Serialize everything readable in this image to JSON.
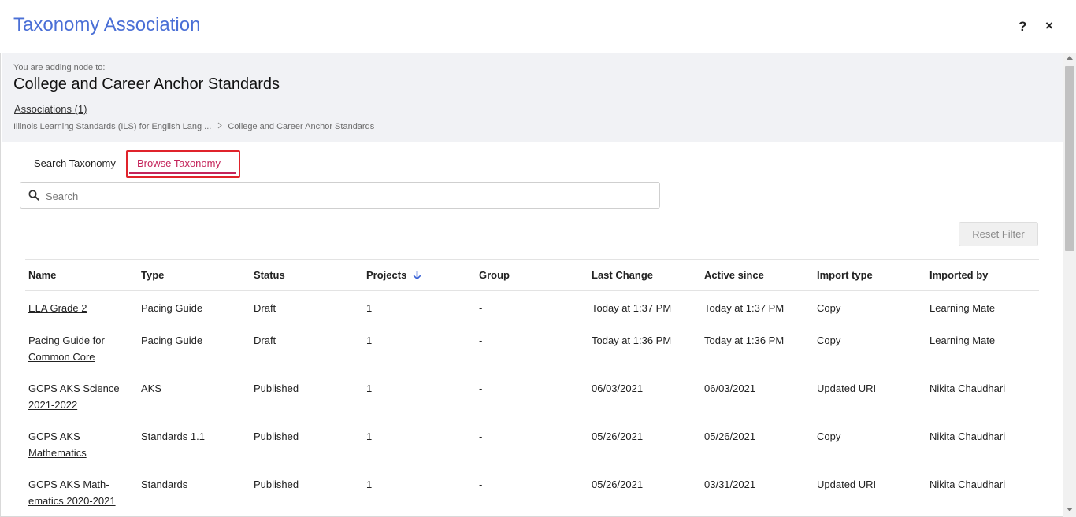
{
  "dialog": {
    "title": "Taxonomy Association",
    "help_label": "?",
    "close_label": "×"
  },
  "context": {
    "label": "You are adding node to:",
    "title": "College and Career Anchor Standards",
    "associations_link": "Associations (1)",
    "breadcrumb": [
      "Illinois Learning Standards (ILS) for English Lang ...",
      "College and Career Anchor Standards"
    ]
  },
  "tabs": {
    "search": "Search Taxonomy",
    "browse": "Browse Taxonomy",
    "active": "browse"
  },
  "search": {
    "placeholder": "Search",
    "value": ""
  },
  "reset_filter_label": "Reset Filter",
  "table": {
    "columns": [
      "Name",
      "Type",
      "Status",
      "Projects",
      "Group",
      "Last Change",
      "Active since",
      "Import type",
      "Imported by"
    ],
    "sorted_column": "Projects",
    "sort_direction": "descending",
    "rows": [
      {
        "name": [
          "ELA Grade 2"
        ],
        "type": "Pacing Guide",
        "status": "Draft",
        "projects": "1",
        "group": "-",
        "last_change": "Today at 1:37 PM",
        "active_since": "Today at 1:37 PM",
        "import_type": "Copy",
        "imported_by": "Learning Mate"
      },
      {
        "name": [
          "Pacing Guide for",
          "Common Core"
        ],
        "type": "Pacing Guide",
        "status": "Draft",
        "projects": "1",
        "group": "-",
        "last_change": "Today at 1:36 PM",
        "active_since": "Today at 1:36 PM",
        "import_type": "Copy",
        "imported_by": "Learning Mate"
      },
      {
        "name": [
          "GCPS AKS Science",
          "2021-2022"
        ],
        "type": "AKS",
        "status": "Published",
        "projects": "1",
        "group": "-",
        "last_change": "06/03/2021",
        "active_since": "06/03/2021",
        "import_type": "Updated URI",
        "imported_by": "Nikita Chaudhari"
      },
      {
        "name": [
          "GCPS AKS",
          "Mathematics"
        ],
        "type": "Standards 1.1",
        "status": "Published",
        "projects": "1",
        "group": "-",
        "last_change": "05/26/2021",
        "active_since": "05/26/2021",
        "import_type": "Copy",
        "imported_by": "Nikita Chaudhari"
      },
      {
        "name": [
          "GCPS AKS Math-",
          "ematics 2020-2021"
        ],
        "type": "Standards",
        "status": "Published",
        "projects": "1",
        "group": "-",
        "last_change": "05/26/2021",
        "active_since": "03/31/2021",
        "import_type": "Updated URI",
        "imported_by": "Nikita Chaudhari"
      }
    ]
  }
}
